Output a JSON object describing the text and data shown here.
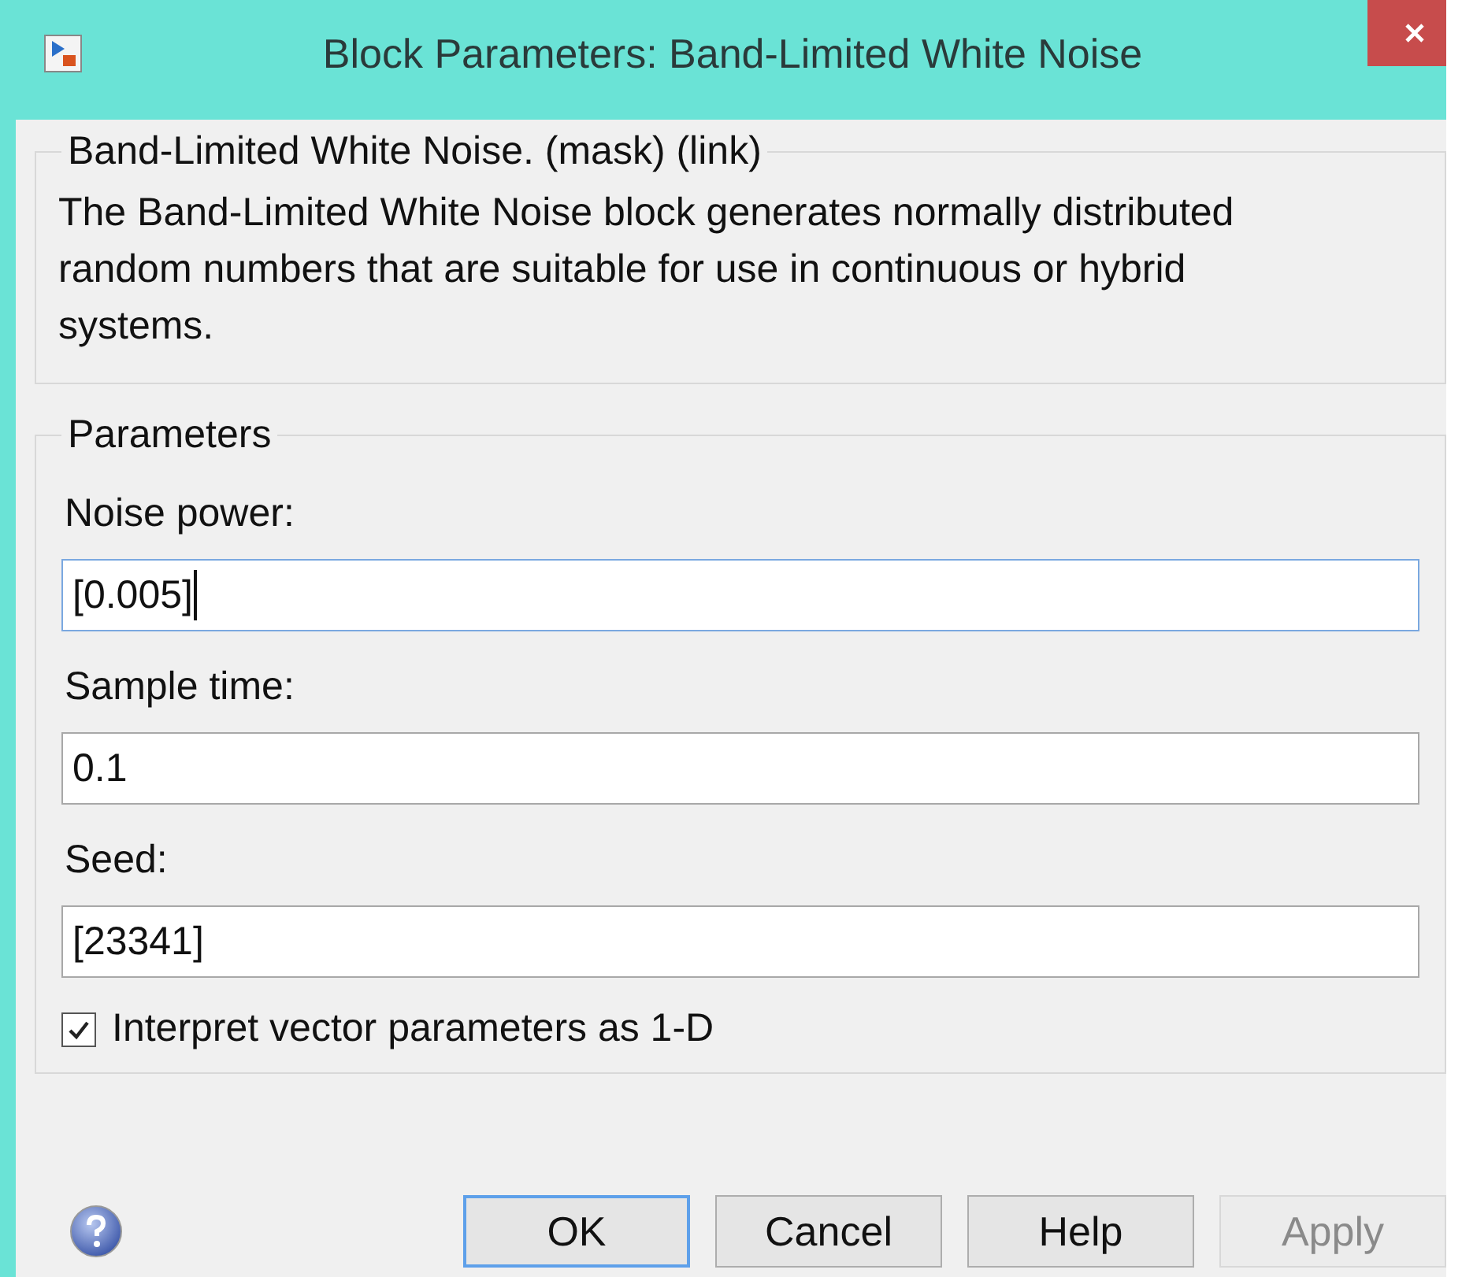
{
  "window": {
    "title": "Block Parameters: Band-Limited White Noise"
  },
  "description": {
    "title": "Band-Limited White Noise. (mask) (link)",
    "text": "The Band-Limited White Noise block generates normally distributed random numbers that are suitable for use in continuous or hybrid systems."
  },
  "parameters": {
    "title": "Parameters",
    "fields": [
      {
        "label": "Noise power:",
        "value": "[0.005]",
        "focused": true
      },
      {
        "label": "Sample time:",
        "value": "0.1",
        "focused": false
      },
      {
        "label": "Seed:",
        "value": "[23341]",
        "focused": false
      }
    ],
    "checkbox": {
      "label": "Interpret vector parameters as 1-D",
      "checked": true
    }
  },
  "buttons": [
    {
      "label": "OK",
      "default": true,
      "disabled": false
    },
    {
      "label": "Cancel",
      "default": false,
      "disabled": false
    },
    {
      "label": "Help",
      "default": false,
      "disabled": false
    },
    {
      "label": "Apply",
      "default": false,
      "disabled": true
    }
  ]
}
